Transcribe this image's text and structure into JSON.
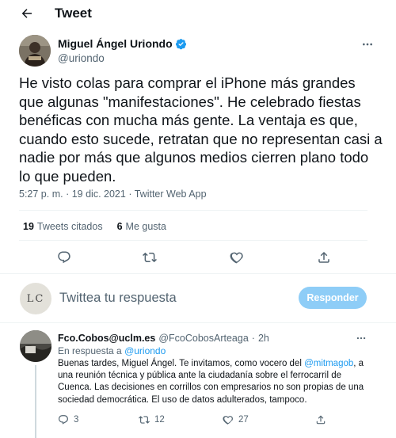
{
  "header": {
    "title": "Tweet",
    "back_icon": "arrow-left-icon"
  },
  "tweet": {
    "author_name": "Miguel Ángel Uriondo",
    "author_handle": "@uriondo",
    "text": "He visto colas para comprar el iPhone más grandes que algunas \"manifestaciones\". He celebrado fiestas benéficas con mucha más gente. La ventaja es que, cuando esto sucede, retratan que no representan casi a nadie por más que algunos medios cierren plano todo lo que pueden.",
    "time": "5:27 p. m.",
    "date": "19 dic. 2021",
    "source": "Twitter Web App",
    "quote_count": "19",
    "quote_label": "Tweets citados",
    "like_count": "6",
    "like_label": "Me gusta"
  },
  "compose": {
    "placeholder": "Twittea tu respuesta",
    "button_label": "Responder",
    "avatar_text": "LC"
  },
  "reply": {
    "author_name": "Fco.Cobos@uclm.es",
    "author_handle": "@FcoCobosArteaga",
    "separator": "·",
    "age": "2h",
    "replying_prefix": "En respuesta a",
    "replying_to": "@uriondo",
    "text_part1": "Buenas tardes, Miguel Ángel. Te invitamos, como vocero del ",
    "mention": "@mitmagob",
    "text_part2": ",  a una reunión técnica y pública ante la ciudadanía sobre el ferrocarril de Cuenca. Las decisiones en corrillos con empresarios no son propias de una sociedad democrática. El uso de datos adulterados, tampoco.",
    "reply_count": "3",
    "retweet_count": "12",
    "like_count": "27"
  },
  "colors": {
    "accent": "#1d9bf0",
    "button_disabled": "#8ecdf7",
    "text_primary": "#0f1419",
    "text_secondary": "#536471",
    "divider": "#eff3f4"
  }
}
